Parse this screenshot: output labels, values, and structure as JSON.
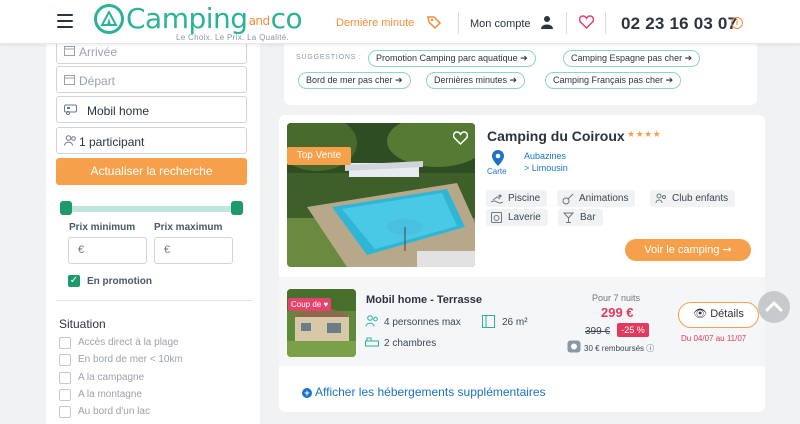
{
  "header": {
    "logo_main": "Camping",
    "logo_and": "and",
    "logo_co": "co",
    "logo_tagline": "Le Choix. Le Prix. La Qualité.",
    "last_minute": "Dernière minute",
    "account": "Mon compte",
    "phone": "02 23 16 03 07"
  },
  "sidebar": {
    "arrival_placeholder": "Arrivée",
    "departure_placeholder": "Départ",
    "accommodation_type": "Mobil home",
    "participants": "1 participant",
    "update_button": "Actualiser la recherche",
    "price_min_label": "Prix minimum",
    "price_max_label": "Prix maximum",
    "currency": "€",
    "promo_label": "En promotion",
    "promo_checked": true,
    "situation_title": "Situation",
    "situation_items": [
      "Accès direct à la plage",
      "En bord de mer < 10km",
      "A la campagne",
      "A la montagne",
      "Au bord d'un lac"
    ]
  },
  "suggestions": {
    "title": "SUGGESTIONS :",
    "chips": [
      "Promotion Camping parc aquatique",
      "Camping Espagne pas cher",
      "Bord de mer pas cher",
      "Dernières minutes",
      "Camping Français pas cher"
    ]
  },
  "result": {
    "badge": "Top Vente",
    "name": "Camping du Coiroux",
    "stars": "★★★★",
    "map_label": "Carte",
    "location_city": "Aubazines",
    "location_region": "Limousin",
    "amenities": [
      "Piscine",
      "Animations",
      "Club enfants",
      "Laverie",
      "Bar"
    ],
    "cta": "Voir le camping",
    "unit": {
      "badge": "Coup de",
      "name": "Mobil home - Terrasse",
      "persons": "4 personnes max",
      "area": "26 m²",
      "rooms": "2 chambres",
      "nights": "Pour 7 nuits",
      "price": "299 €",
      "old_price": "399 €",
      "discount": "-25 %",
      "refund": "30 € remboursés",
      "details_button": "Détails",
      "dates": "Du 04/07 au 11/07"
    },
    "more_link": "Afficher les hébergements supplémentaires"
  },
  "colors": {
    "brand_green": "#2bb39a",
    "brand_orange": "#f7a04b",
    "price_red": "#e23a5e",
    "link_blue": "#1a73c7"
  }
}
